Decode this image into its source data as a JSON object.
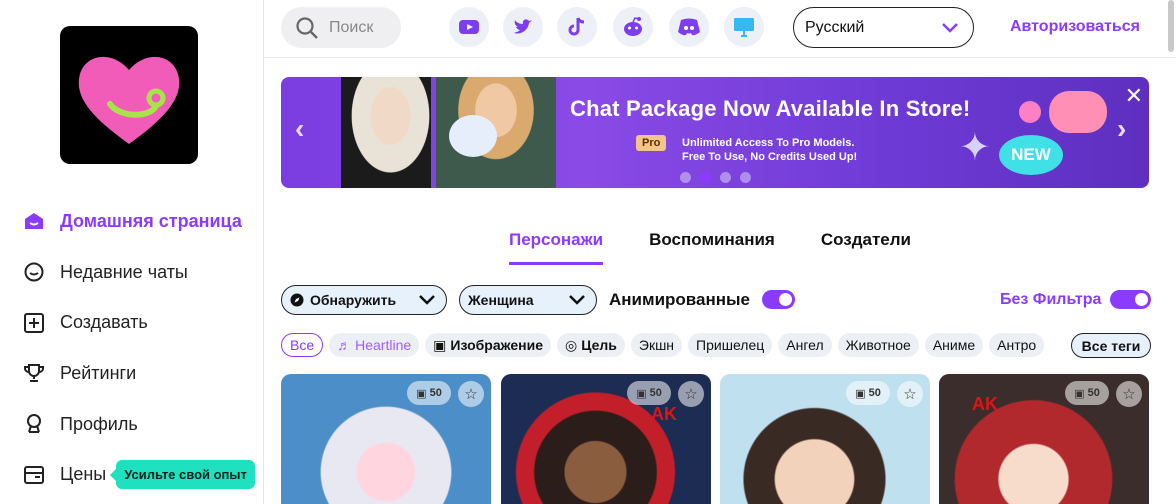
{
  "sidebar": {
    "items": [
      {
        "label": "Домашняя страница",
        "active": true
      },
      {
        "label": "Недавние чаты"
      },
      {
        "label": "Создавать"
      },
      {
        "label": "Рейтинги"
      },
      {
        "label": "Профиль"
      },
      {
        "label": "Цены"
      }
    ],
    "promo": "Усильте свой опыт"
  },
  "header": {
    "search_placeholder": "Поиск",
    "social": [
      "youtube-icon",
      "twitter-icon",
      "tiktok-icon",
      "reddit-icon",
      "discord-icon",
      "desktop-icon"
    ],
    "language": "Русский",
    "login": "Авторизоваться"
  },
  "banner": {
    "title": "Chat Package Now Available In Store!",
    "badge": "Pro",
    "line1": "Unlimited Access To Pro Models.",
    "line2": "Free To Use, No Credits Used Up!",
    "new_label": "NEW"
  },
  "tabs": [
    "Персонажи",
    "Воспоминания",
    "Создатели"
  ],
  "filters": {
    "discover": "Обнаружить",
    "gender": "Женщина",
    "animated_label": "Анимированные",
    "animated_on": true,
    "nofilter_label": "Без Фильтра",
    "nofilter_on": true
  },
  "tags": [
    "Все",
    "Heartline",
    "Изображение",
    "Цель",
    "Экшн",
    "Пришелец",
    "Ангел",
    "Животное",
    "Аниме",
    "Антро"
  ],
  "all_tags": "Все теги",
  "cards": [
    {
      "count": "50"
    },
    {
      "count": "50"
    },
    {
      "count": "50"
    },
    {
      "count": "50"
    }
  ],
  "colors": {
    "accent": "#8b3bff",
    "promo": "#1fe0bf"
  }
}
